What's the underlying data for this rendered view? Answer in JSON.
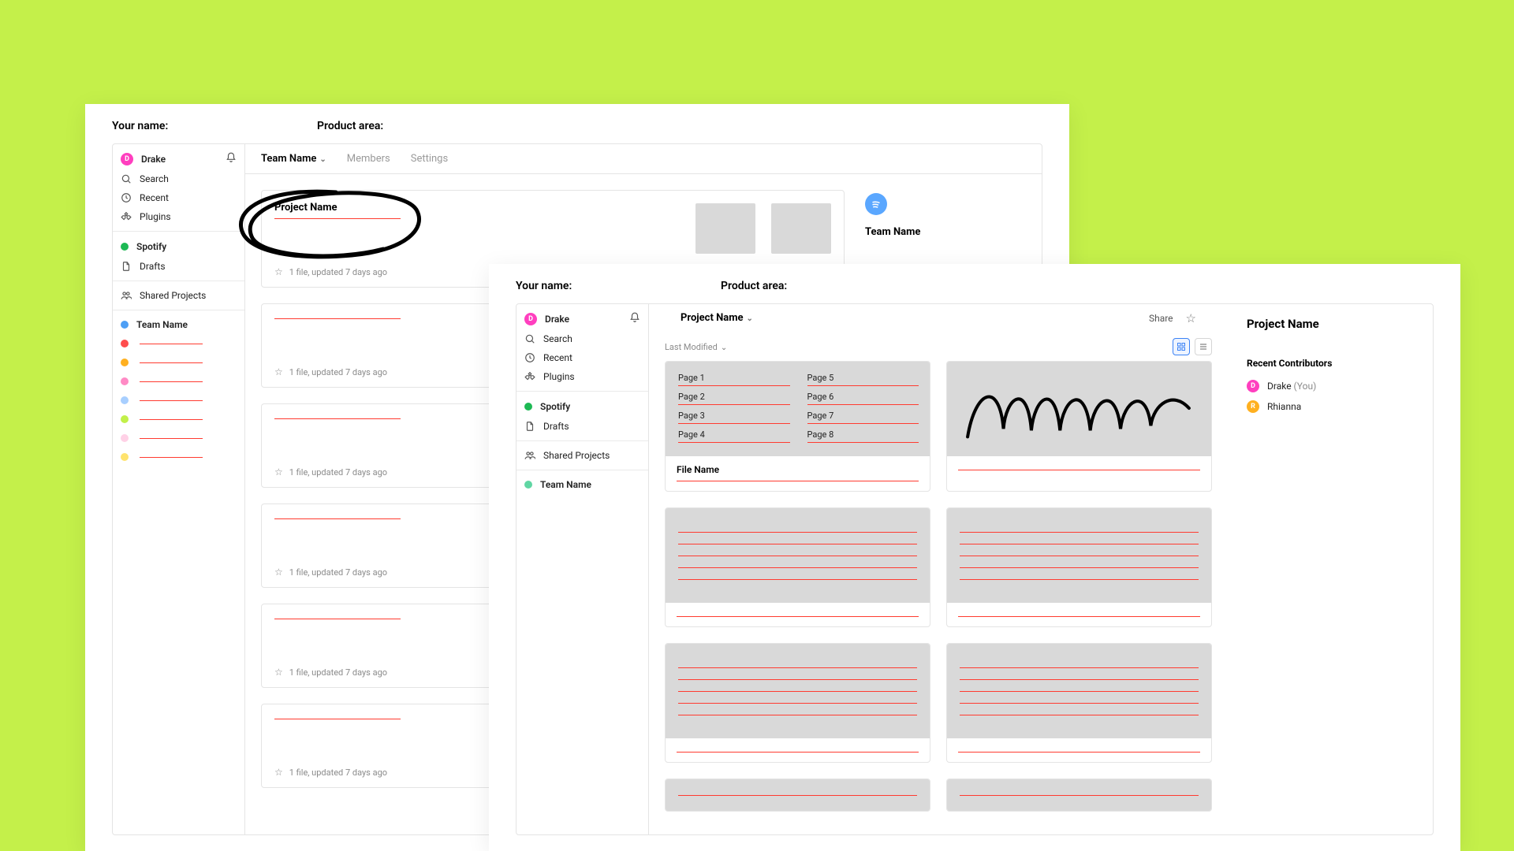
{
  "labels": {
    "your_name": "Your name:",
    "product_area": "Product area:"
  },
  "back": {
    "user": "Drake",
    "nav": {
      "search": "Search",
      "recent": "Recent",
      "plugins": "Plugins"
    },
    "org": "Spotify",
    "drafts": "Drafts",
    "shared": "Shared Projects",
    "team": "Team Name",
    "tabs": {
      "team": "Team Name",
      "members": "Members",
      "settings": "Settings"
    },
    "project_title": "Project Name",
    "file_meta": "1 file, updated 7 days ago",
    "side_team": "Team Name"
  },
  "front": {
    "user": "Drake",
    "nav": {
      "search": "Search",
      "recent": "Recent",
      "plugins": "Plugins"
    },
    "org": "Spotify",
    "drafts": "Drafts",
    "shared": "Shared Projects",
    "team": "Team Name",
    "breadcrumb": "Project Name",
    "share": "Share",
    "sort": "Last Modified",
    "file_name": "File Name",
    "pages_left": [
      "Page 1",
      "Page 2",
      "Page 3",
      "Page 4"
    ],
    "pages_right": [
      "Page 5",
      "Page 6",
      "Page 7",
      "Page 8"
    ],
    "side": {
      "title": "Project Name",
      "section": "Recent Contributors",
      "c1": "Drake",
      "you": "(You)",
      "c2": "Rhianna"
    }
  }
}
